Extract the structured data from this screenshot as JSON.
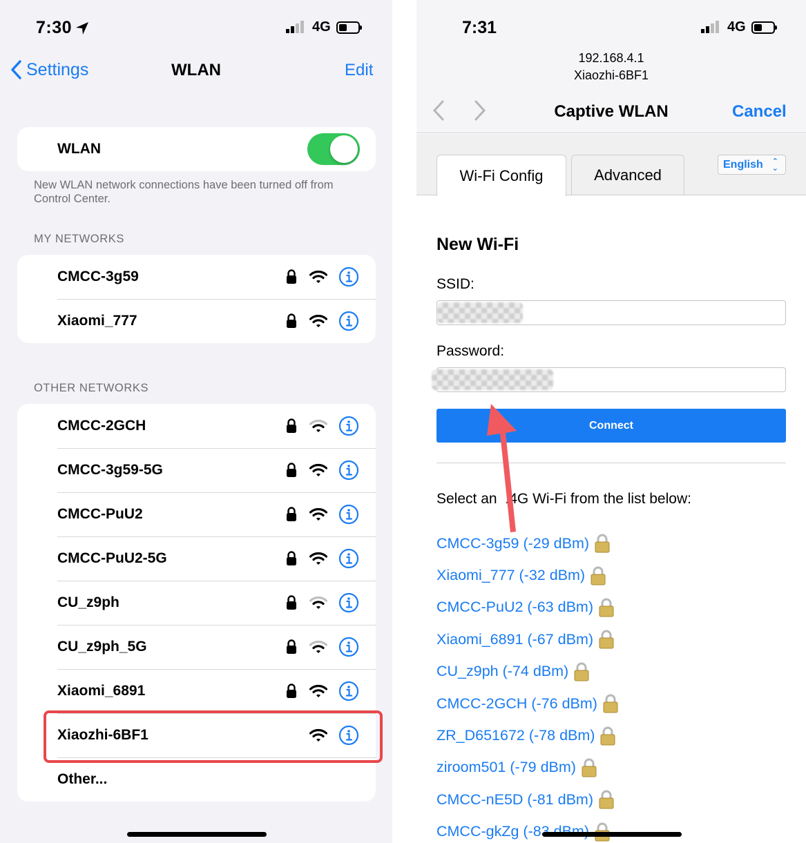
{
  "left": {
    "status": {
      "time": "7:30",
      "network": "4G"
    },
    "nav": {
      "back_label": "Settings",
      "title": "WLAN",
      "edit_label": "Edit"
    },
    "wlan_toggle": {
      "label": "WLAN",
      "on": true
    },
    "footnote": "New WLAN network connections have been turned off from Control Center.",
    "my_networks_header": "MY NETWORKS",
    "my_networks": [
      {
        "name": "CMCC-3g59",
        "locked": true,
        "strength": 3
      },
      {
        "name": "Xiaomi_777",
        "locked": true,
        "strength": 3
      }
    ],
    "other_networks_header": "OTHER NETWORKS",
    "other_networks": [
      {
        "name": "CMCC-2GCH",
        "locked": true,
        "strength": 2
      },
      {
        "name": "CMCC-3g59-5G",
        "locked": true,
        "strength": 3
      },
      {
        "name": "CMCC-PuU2",
        "locked": true,
        "strength": 3
      },
      {
        "name": "CMCC-PuU2-5G",
        "locked": true,
        "strength": 3
      },
      {
        "name": "CU_z9ph",
        "locked": true,
        "strength": 2
      },
      {
        "name": "CU_z9ph_5G",
        "locked": true,
        "strength": 2
      },
      {
        "name": "Xiaomi_6891",
        "locked": true,
        "strength": 3
      },
      {
        "name": "Xiaozhi-6BF1",
        "locked": false,
        "strength": 3
      }
    ],
    "other_label": "Other..."
  },
  "right": {
    "status": {
      "time": "7:31",
      "network": "4G"
    },
    "url_host": "192.168.4.1",
    "url_ssid": "Xiaozhi-6BF1",
    "title": "Captive WLAN",
    "cancel_label": "Cancel",
    "tabs": [
      "Wi-Fi Config",
      "Advanced"
    ],
    "language": "English",
    "heading": "New Wi-Fi",
    "ssid_label": "SSID:",
    "password_label": "Password:",
    "connect_label": "Connect",
    "select_prefix": "Select an",
    "select_suffix": ".4G Wi-Fi from the list below:",
    "networks": [
      "CMCC-3g59 (-29 dBm)",
      "Xiaomi_777 (-32 dBm)",
      "CMCC-PuU2 (-63 dBm)",
      "Xiaomi_6891 (-67 dBm)",
      "CU_z9ph (-74 dBm)",
      "CMCC-2GCH (-76 dBm)",
      "ZR_D651672 (-78 dBm)",
      "ziroom501 (-79 dBm)",
      "CMCC-nE5D (-81 dBm)",
      "CMCC-gkZg (-83 dBm)"
    ]
  },
  "colors": {
    "ios_blue": "#1a7cf2",
    "toggle_green": "#34c759",
    "highlight_red": "#e8474c",
    "arrow_red": "#f05a5f"
  }
}
